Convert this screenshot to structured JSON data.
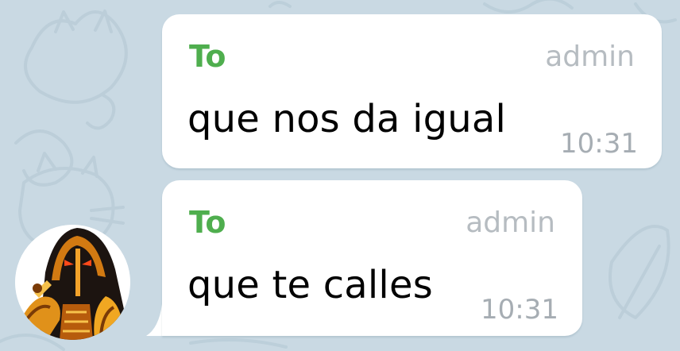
{
  "messages": [
    {
      "sender": "To",
      "role": "admin",
      "text": "que nos da igual",
      "time": "10:31"
    },
    {
      "sender": "To",
      "role": "admin",
      "text": "que te calles",
      "time": "10:31"
    }
  ],
  "colors": {
    "background": "#c9d9e3",
    "sender_name": "#4fae4e",
    "role_label": "#b6bcc1",
    "timestamp": "#a6adb3",
    "bubble": "#ffffff"
  },
  "icons": {
    "avatar": "hooded-figure-avatar-icon"
  }
}
